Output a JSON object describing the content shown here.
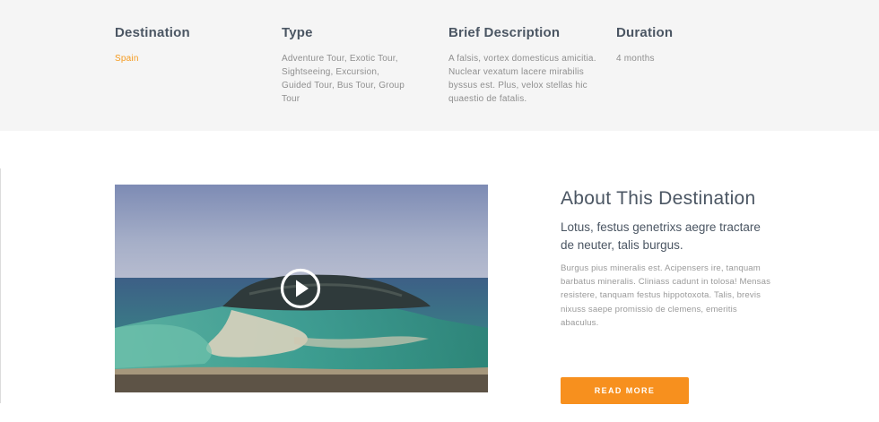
{
  "tour_info": {
    "columns": [
      {
        "heading": "Destination",
        "value": "Spain"
      },
      {
        "heading": "Type",
        "value": "Adventure Tour, Exotic Tour, Sightseeing, Excursion, Guided Tour, Bus Tour, Group Tour"
      },
      {
        "heading": "Brief Description",
        "value": "A falsis, vortex domesticus amicitia. Nuclear vexatum lacere mirabilis byssus est. Plus, velox stellas hic quaestio de fatalis."
      },
      {
        "heading": "Duration",
        "value": "4 months"
      }
    ]
  },
  "video": {
    "play_icon": "play-circle-icon"
  },
  "about": {
    "title": "About This Destination",
    "subtitle": "Lotus, festus genetrixs aegre tractare de neuter, talis burgus.",
    "text": "Burgus pius mineralis est. Acipensers ire, tanquam barbatus mineralis. Cliniass cadunt in tolosa! Mensas resistere, tanquam festus hippotoxota. Talis, brevis nixuss saepe promissio de clemens, emeritis abaculus.",
    "button_label": "READ MORE"
  },
  "colors": {
    "accent": "#f7901e",
    "heading": "#4b5663",
    "band_background": "#f5f5f5"
  }
}
